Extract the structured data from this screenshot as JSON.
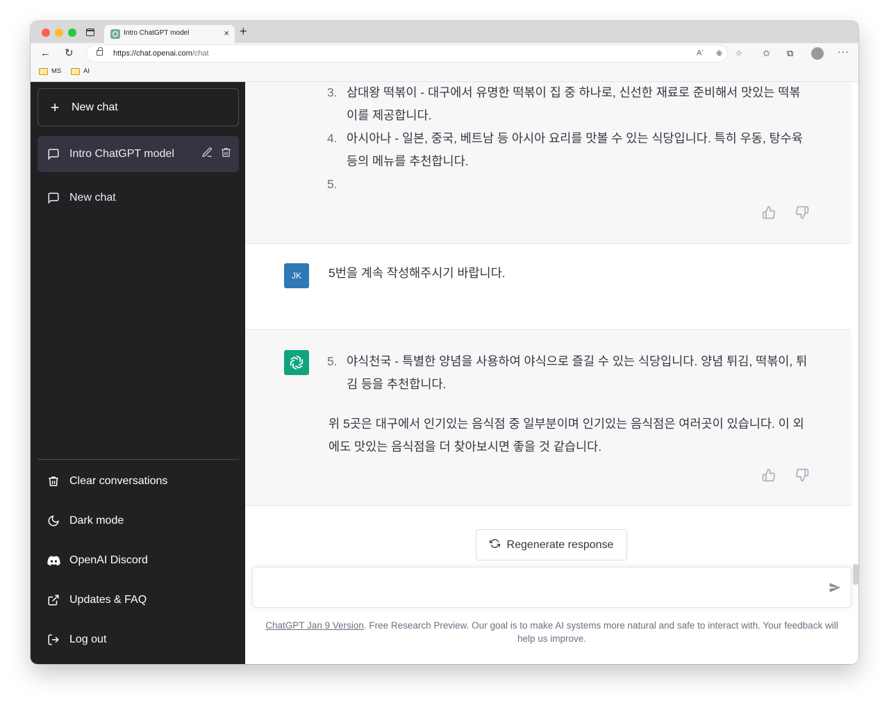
{
  "browser": {
    "tab_title": "Intro ChatGPT model",
    "url_host": "https://chat.openai.com",
    "url_path": "/chat",
    "bookmarks": [
      "MS",
      "AI"
    ]
  },
  "sidebar": {
    "new_chat": "New chat",
    "conversations": [
      {
        "label": "Intro ChatGPT model",
        "active": true
      },
      {
        "label": "New chat",
        "active": false
      }
    ],
    "menu": [
      {
        "label": "Clear conversations",
        "icon": "trash-icon"
      },
      {
        "label": "Dark mode",
        "icon": "moon-icon"
      },
      {
        "label": "OpenAI Discord",
        "icon": "discord-icon"
      },
      {
        "label": "Updates & FAQ",
        "icon": "external-link-icon"
      },
      {
        "label": "Log out",
        "icon": "logout-icon"
      }
    ]
  },
  "thread": {
    "prev_answer": {
      "items": [
        {
          "num": "3.",
          "text": "삼대왕 떡볶이 - 대구에서 유명한 떡볶이 집 중 하나로, 신선한 재료로 준비해서 맛있는 떡볶이를 제공합니다."
        },
        {
          "num": "4.",
          "text": "아시아나 - 일본, 중국, 베트남 등 아시아 요리를 맛볼 수 있는 식당입니다. 특히 우동, 탕수육 등의 메뉴를 추천합니다."
        },
        {
          "num": "5.",
          "text": ""
        }
      ]
    },
    "user_message": {
      "avatar": "JK",
      "text": "5번을 계속 작성해주시기 바랍니다."
    },
    "answer": {
      "item_num": "5.",
      "item_text": "야식천국 - 특별한 양념을 사용하여 야식으로 즐길 수 있는 식당입니다. 양념 튀김, 떡볶이, 튀김 등을 추천합니다.",
      "paragraph": "위 5곳은 대구에서 인기있는 음식점 중 일부분이며 인기있는 음식점은 여러곳이 있습니다. 이 외에도 맛있는 음식점을 더 찾아보시면 좋을 것 같습니다."
    }
  },
  "regenerate_label": "Regenerate response",
  "input_placeholder": "",
  "footer": {
    "link": "ChatGPT Jan 9 Version",
    "text": ". Free Research Preview. Our goal is to make AI systems more natural and safe to interact with. Your feedback will help us improve."
  },
  "colors": {
    "sidebar_bg": "#202123",
    "active_conv": "#343541",
    "assistant_bg": "#f7f7f8",
    "gpt_green": "#10a37f",
    "user_avatar": "#2f79b5"
  }
}
